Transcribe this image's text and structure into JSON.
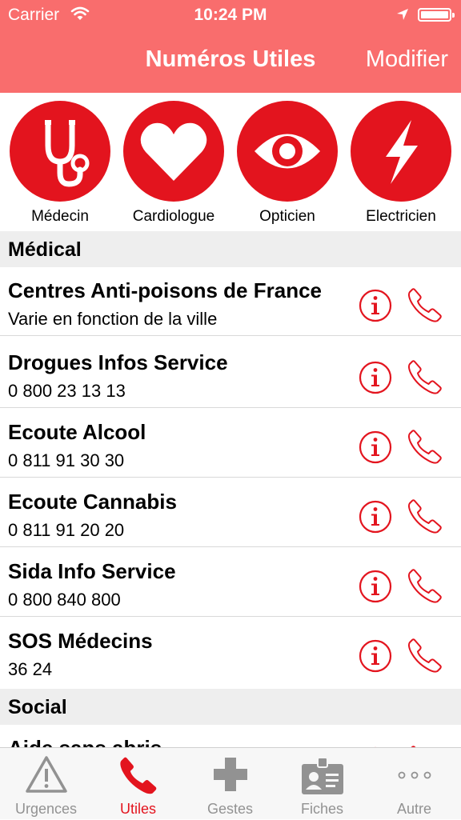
{
  "status_bar": {
    "carrier": "Carrier",
    "time": "10:24 PM"
  },
  "nav": {
    "title": "Numéros Utiles",
    "right_button": "Modifier"
  },
  "shortcuts": [
    {
      "icon": "stethoscope-icon",
      "label": "Médecin"
    },
    {
      "icon": "heart-icon",
      "label": "Cardiologue"
    },
    {
      "icon": "eye-icon",
      "label": "Opticien"
    },
    {
      "icon": "lightning-icon",
      "label": "Electricien"
    }
  ],
  "sections": {
    "medical": {
      "title": "Médical",
      "rows": [
        {
          "name": "Centres Anti-poisons de France",
          "detail": "Varie en fonction de la ville"
        },
        {
          "name": "Drogues Infos Service",
          "detail": "0 800 23 13 13"
        },
        {
          "name": "Ecoute Alcool",
          "detail": "0 811 91 30 30"
        },
        {
          "name": "Ecoute Cannabis",
          "detail": "0 811 91 20 20"
        },
        {
          "name": "Sida Info Service",
          "detail": "0 800 840 800"
        },
        {
          "name": "SOS Médecins",
          "detail": "36 24"
        }
      ]
    },
    "social": {
      "title": "Social",
      "rows": [
        {
          "name": "Aide sans abris",
          "detail": ""
        }
      ]
    }
  },
  "tabs": [
    {
      "icon": "warning-icon",
      "label": "Urgences",
      "active": false
    },
    {
      "icon": "phone-icon",
      "label": "Utiles",
      "active": true
    },
    {
      "icon": "cross-icon",
      "label": "Gestes",
      "active": false
    },
    {
      "icon": "id-card-icon",
      "label": "Fiches",
      "active": false
    },
    {
      "icon": "more-icon",
      "label": "Autre",
      "active": false
    }
  ],
  "colors": {
    "accent": "#e3141e",
    "navbar": "#f96d6d",
    "tab_inactive": "#929292"
  }
}
